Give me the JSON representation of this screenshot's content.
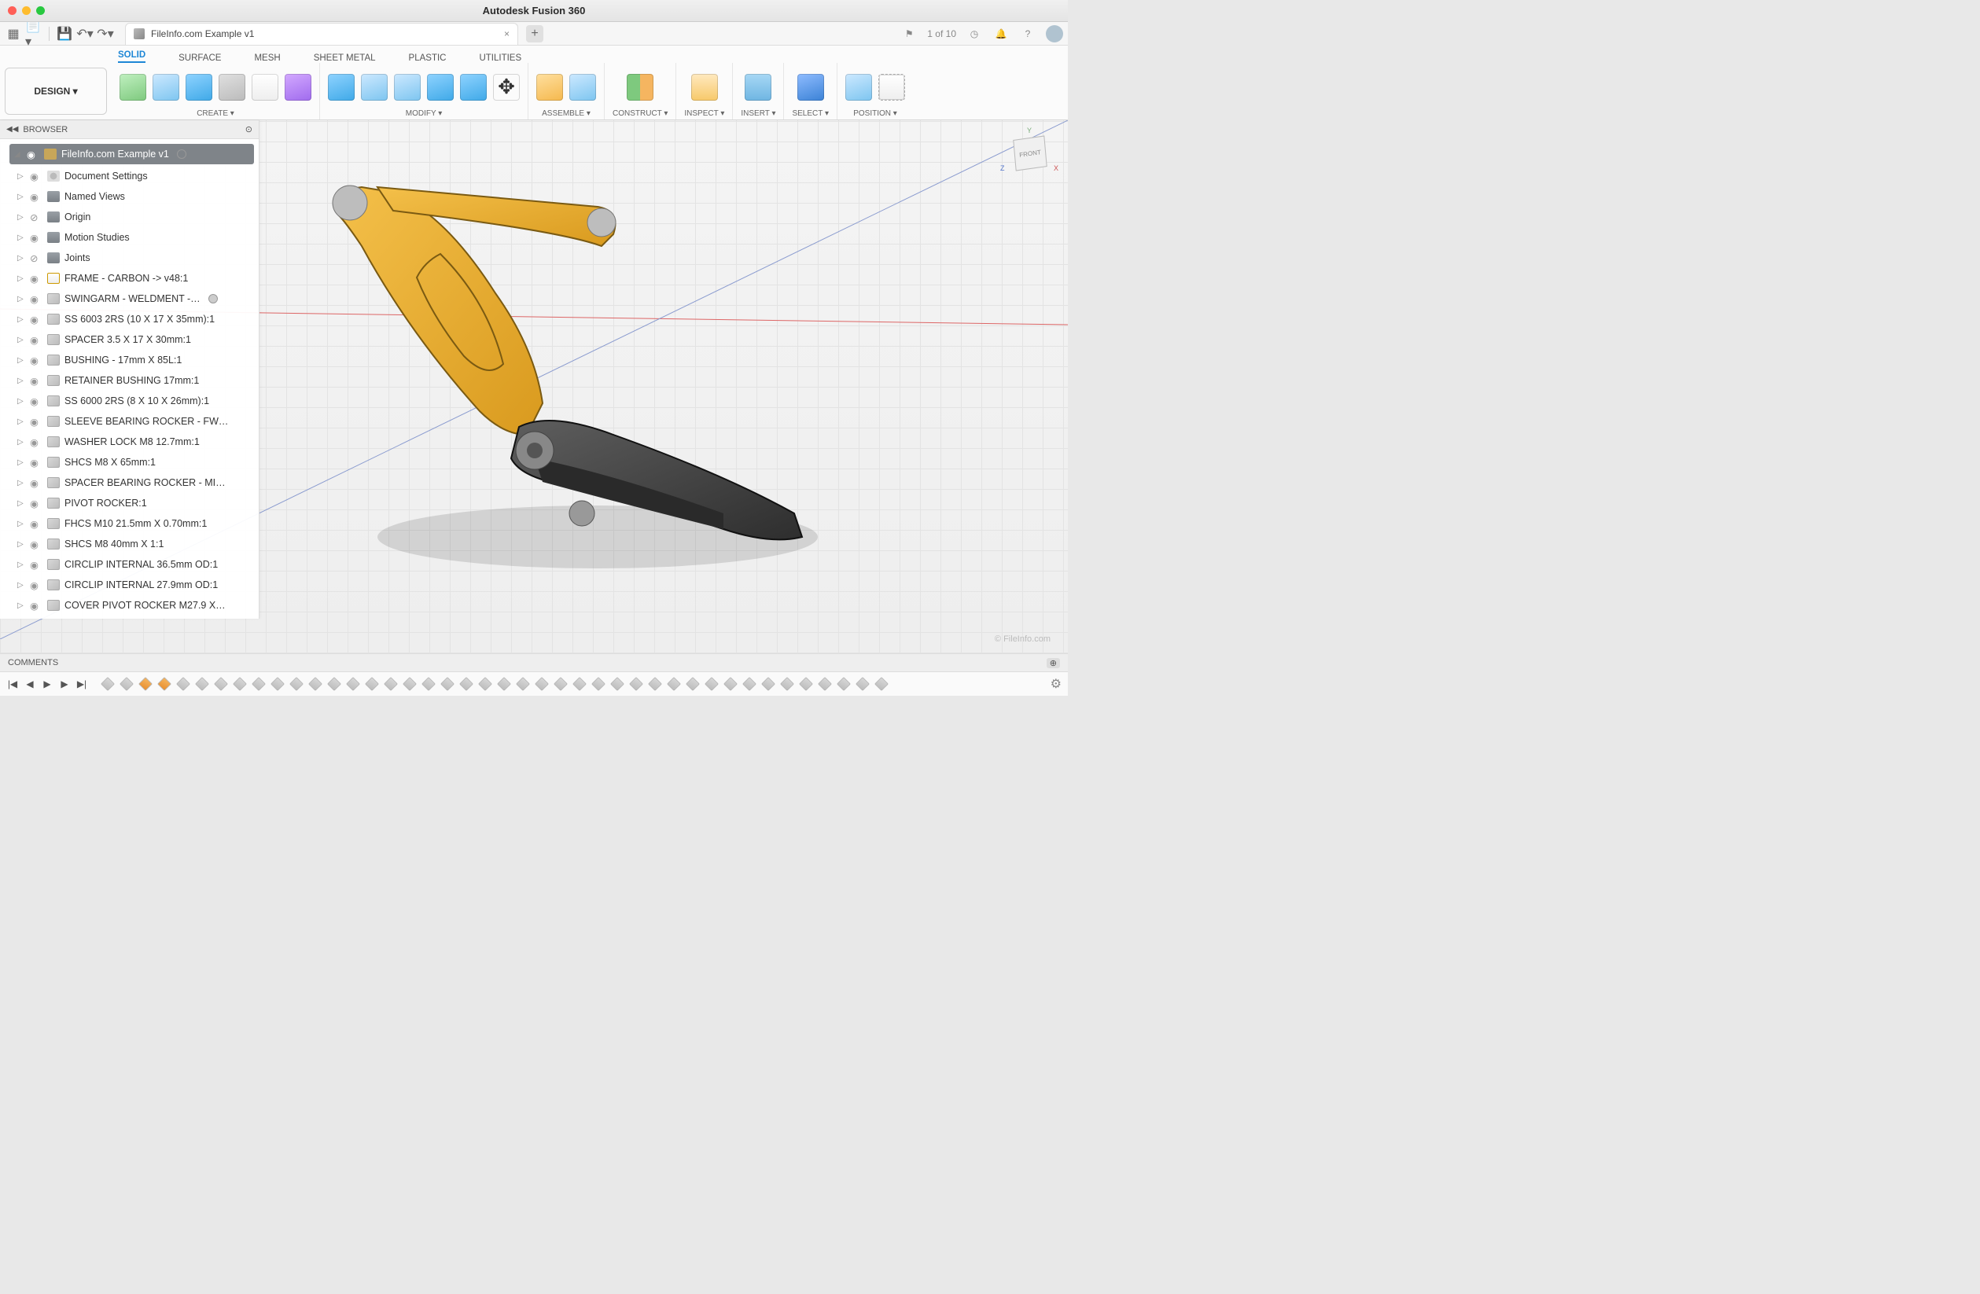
{
  "app": {
    "title": "Autodesk Fusion 360"
  },
  "doc": {
    "tab_label": "FileInfo.com Example v1",
    "close": "×"
  },
  "qat": {
    "job_count": "1 of 10"
  },
  "workspace": {
    "label": "DESIGN ▾"
  },
  "ribbon": {
    "tabs": [
      "SOLID",
      "SURFACE",
      "MESH",
      "SHEET METAL",
      "PLASTIC",
      "UTILITIES"
    ],
    "active_tab": 0,
    "groups": {
      "create": "CREATE ▾",
      "modify": "MODIFY ▾",
      "assemble": "ASSEMBLE ▾",
      "construct": "CONSTRUCT ▾",
      "inspect": "INSPECT ▾",
      "insert": "INSERT ▾",
      "select": "SELECT ▾",
      "position": "POSITION ▾"
    }
  },
  "browser": {
    "title": "BROWSER",
    "root": "FileInfo.com Example v1",
    "items": [
      {
        "icon": "gear",
        "label": "Document Settings"
      },
      {
        "icon": "folder",
        "label": "Named Views"
      },
      {
        "icon": "folder",
        "label": "Origin",
        "hidden": true
      },
      {
        "icon": "folder",
        "label": "Motion Studies"
      },
      {
        "icon": "folder",
        "label": "Joints",
        "hidden": true
      },
      {
        "icon": "doc",
        "label": "FRAME - CARBON -> v48:1"
      },
      {
        "icon": "comp",
        "label": "SWINGARM - WELDMENT -…",
        "dot": true
      },
      {
        "icon": "comp",
        "label": "SS 6003 2RS (10 X 17 X 35mm):1"
      },
      {
        "icon": "comp",
        "label": "SPACER 3.5 X 17 X 30mm:1"
      },
      {
        "icon": "comp",
        "label": "BUSHING - 17mm X 85L:1"
      },
      {
        "icon": "comp",
        "label": "RETAINER BUSHING 17mm:1"
      },
      {
        "icon": "comp",
        "label": "SS 6000 2RS (8 X 10 X 26mm):1"
      },
      {
        "icon": "comp",
        "label": "SLEEVE BEARING ROCKER - FW…"
      },
      {
        "icon": "comp",
        "label": "WASHER LOCK M8 12.7mm:1"
      },
      {
        "icon": "comp",
        "label": "SHCS M8 X 65mm:1"
      },
      {
        "icon": "comp",
        "label": "SPACER BEARING ROCKER - MI…"
      },
      {
        "icon": "comp",
        "label": "PIVOT ROCKER:1"
      },
      {
        "icon": "comp",
        "label": "FHCS M10 21.5mm X 0.70mm:1"
      },
      {
        "icon": "comp",
        "label": "SHCS M8 40mm X 1:1"
      },
      {
        "icon": "comp",
        "label": "CIRCLIP INTERNAL 36.5mm OD:1"
      },
      {
        "icon": "comp",
        "label": "CIRCLIP INTERNAL 27.9mm OD:1"
      },
      {
        "icon": "comp",
        "label": "COVER PIVOT ROCKER M27.9 X…"
      }
    ]
  },
  "viewcube": {
    "front": "FRONT",
    "axes": {
      "x": "X",
      "y": "Y",
      "z": "Z"
    }
  },
  "comments": {
    "title": "COMMENTS"
  },
  "watermark": "© FileInfo.com",
  "timeline": {
    "count": 42
  }
}
